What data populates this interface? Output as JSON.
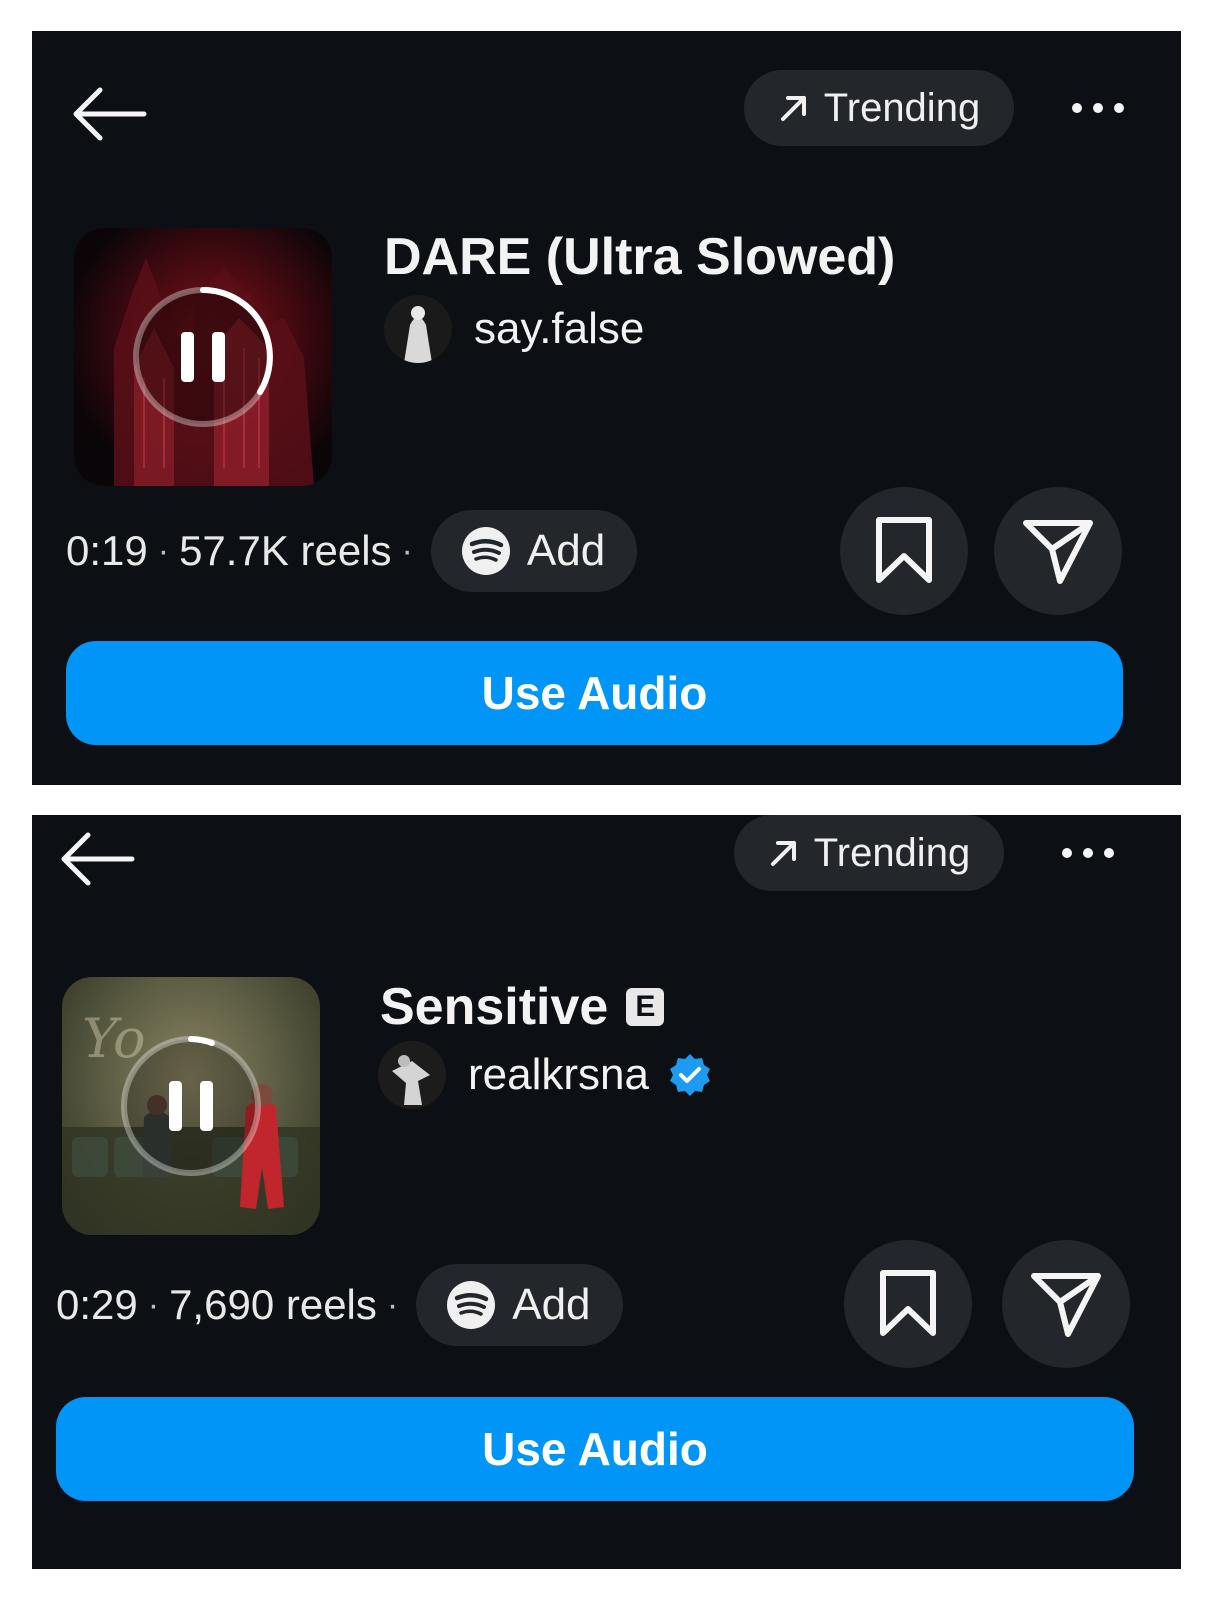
{
  "cards": [
    {
      "trending_label": "Trending",
      "title": "DARE (Ultra Slowed)",
      "explicit": "",
      "artist": "say.false",
      "verified": false,
      "duration": "0:19",
      "reels": "57.7K reels",
      "add_label": "Add",
      "use_audio_label": "Use Audio",
      "playback_progress": 0.3
    },
    {
      "trending_label": "Trending",
      "title": "Sensitive",
      "explicit": "E",
      "artist": "realkrsna",
      "verified": true,
      "duration": "0:29",
      "reels": "7,690 reels",
      "add_label": "Add",
      "use_audio_label": "Use Audio",
      "playback_progress": 0.05
    }
  ],
  "colors": {
    "panel_bg": "#0c1014",
    "pill_bg": "#23272c",
    "accent_blue": "#0095f6",
    "verified_blue": "#1d9bf0",
    "text": "#f3f3f3"
  },
  "icons": {
    "back": "arrow-left-icon",
    "trending": "arrow-up-right-icon",
    "more": "more-horizontal-icon",
    "pause": "pause-icon",
    "spotify": "spotify-icon",
    "save": "bookmark-icon",
    "share": "send-icon",
    "verified": "verified-badge-icon"
  }
}
